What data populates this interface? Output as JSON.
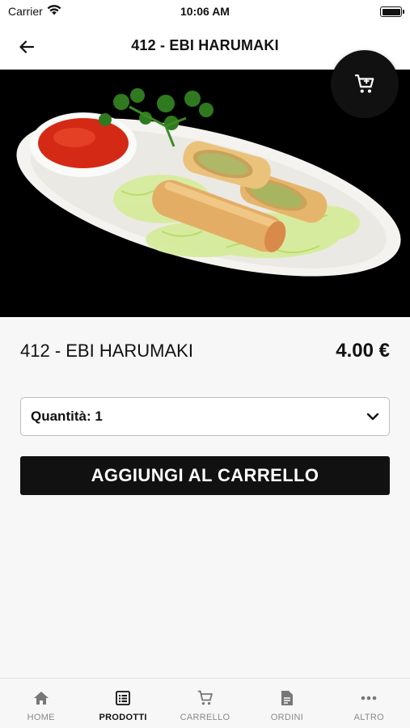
{
  "status_bar": {
    "carrier": "Carrier",
    "time": "10:06 AM"
  },
  "header": {
    "title": "412 - EBI HARUMAKI",
    "back_icon": "arrow-left-icon"
  },
  "hero": {
    "carousel_pages": 1,
    "carousel_current": 1,
    "cart_icon": "cart-icon"
  },
  "product": {
    "name": "412 - EBI HARUMAKI",
    "price": "4.00 €"
  },
  "quantity": {
    "label": "Quantità: 1",
    "icon": "chevron-down-icon"
  },
  "add_to_cart": {
    "label": "AGGIUNGI AL CARRELLO"
  },
  "bottom_nav": {
    "items": [
      {
        "label": "HOME",
        "icon": "home-icon",
        "active": false
      },
      {
        "label": "PRODOTTI",
        "icon": "list-icon",
        "active": true
      },
      {
        "label": "CARRELLO",
        "icon": "cart-icon",
        "active": false
      },
      {
        "label": "ORDINI",
        "icon": "document-icon",
        "active": false
      },
      {
        "label": "ALTRO",
        "icon": "more-icon",
        "active": false
      }
    ]
  },
  "colors": {
    "primary": "#111111",
    "background": "#f7f7f7",
    "inactive": "#8a8a8a"
  }
}
